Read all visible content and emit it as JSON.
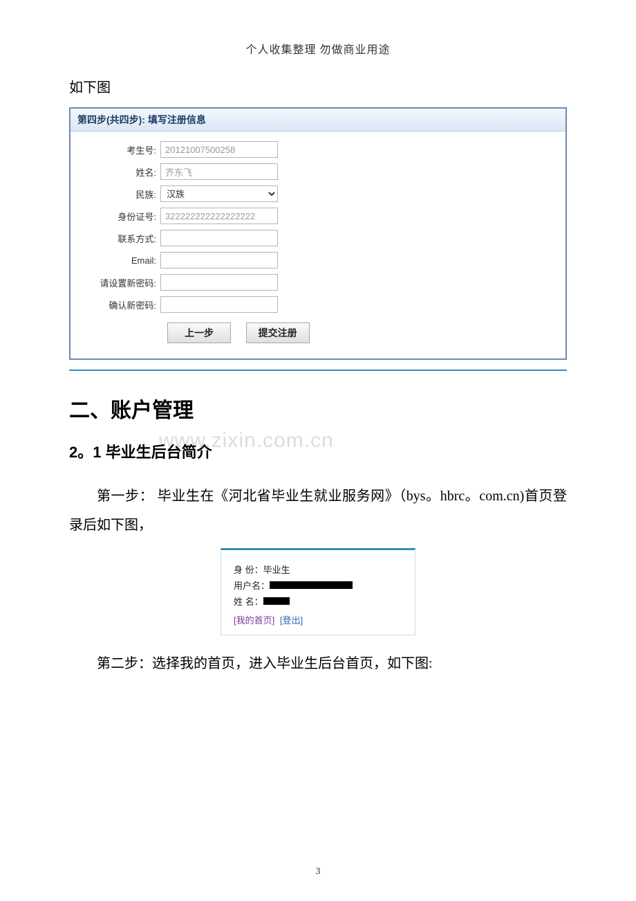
{
  "doc_header": "个人收集整理 勿做商业用途",
  "caption_above_shot1": "如下图",
  "form_box": {
    "title": "第四步(共四步): 填写注册信息",
    "fields": {
      "exam_no": {
        "label": "考生号:",
        "value": "20121007500258"
      },
      "name": {
        "label": "姓名:",
        "value": "齐东飞"
      },
      "ethnicity": {
        "label": "民族:",
        "value": "汉族"
      },
      "id_no": {
        "label": "身份证号:",
        "value": "322222222222222222"
      },
      "contact": {
        "label": "联系方式:",
        "value": ""
      },
      "email": {
        "label": "Email:",
        "value": ""
      },
      "new_pwd": {
        "label": "请设置新密码:",
        "value": ""
      },
      "confirm_pwd": {
        "label": "确认新密码:",
        "value": ""
      }
    },
    "buttons": {
      "prev": "上一步",
      "submit": "提交注册"
    }
  },
  "section_heading": "二、账户管理",
  "subsection_heading": "2。1 毕业生后台简介",
  "watermark": "www.zixin.com.cn",
  "para_step1": "第一步：  毕业生在《河北省毕业生就业服务网》（bys。hbrc。com.cn)首页登录后如下图，",
  "login_box": {
    "identity": {
      "label": "身   份：",
      "value": "毕业生"
    },
    "username": {
      "label": "用户名："
    },
    "name": {
      "label": "姓   名："
    },
    "links": {
      "home": "[我的首页]",
      "logout": "[登出]"
    }
  },
  "para_step2": "第二步：选择我的首页，进入毕业生后台首页，如下图:",
  "page_number": "3"
}
